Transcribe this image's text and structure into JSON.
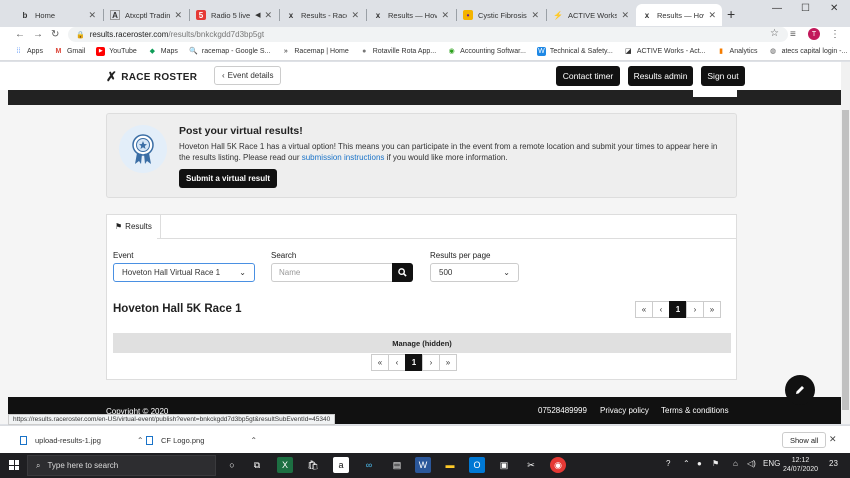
{
  "browser": {
    "tabs": [
      {
        "title": "Home",
        "icon": "b"
      },
      {
        "title": "Atxcptl Trading Pl",
        "icon": "A"
      },
      {
        "title": "Radio 5 live",
        "icon": "5"
      },
      {
        "title": "Results - Race Ro",
        "icon": "x"
      },
      {
        "title": "Results — Hovet",
        "icon": "x"
      },
      {
        "title": "Cystic Fibrosis Tru",
        "icon": "•"
      },
      {
        "title": "ACTIVE Works",
        "icon": "⚡"
      },
      {
        "title": "Results — Hovet",
        "icon": "x"
      }
    ],
    "url_host": "results.raceroster.com",
    "url_path": "/results/bnkckgdd7d3bp5gt",
    "profile_initial": "T",
    "bookmarks": [
      "Apps",
      "Gmail",
      "YouTube",
      "Maps",
      "racemap - Google S...",
      "Racemap | Home",
      "Rotaville Rota App...",
      "Accounting Softwar...",
      "Technical & Safety...",
      "ACTIVE Works - Act...",
      "Analytics",
      "atecs capital login -..."
    ]
  },
  "site": {
    "logo_text": "RACE ROSTER",
    "event_details": "Event details",
    "contact_timer": "Contact timer",
    "results_admin": "Results admin",
    "sign_out": "Sign out"
  },
  "promo": {
    "title": "Post your virtual results!",
    "body_before_link": "Hoveton Hall 5K Race 1 has a virtual option! This means you can participate in the event from a remote location and submit your times to appear here in the results listing. Please read our ",
    "link_text": "submission instructions",
    "body_after_link": " if you would like more information.",
    "button": "Submit a virtual result"
  },
  "results": {
    "tab_label": "Results",
    "event_label": "Event",
    "event_value": "Hoveton Hall Virtual Race 1",
    "search_label": "Search",
    "search_placeholder": "Name",
    "per_page_label": "Results per page",
    "per_page_value": "500",
    "race_title": "Hoveton Hall 5K Race 1",
    "current_page": "1",
    "manage_label": "Manage (hidden)"
  },
  "footer": {
    "copyright": "Copyright © 2020",
    "phone": "07528489999",
    "privacy": "Privacy policy",
    "terms": "Terms & conditions"
  },
  "status_url": "https://results.raceroster.com/en-US/virtual-event/publish?event=bnkckgdd7d3bp5gt&resultSubEventId=45340",
  "downloads": {
    "items": [
      "upload-results-1.jpg",
      "CF Logo.png"
    ],
    "show_all": "Show all"
  },
  "taskbar": {
    "search_placeholder": "Type here to search",
    "lang": "ENG",
    "time": "12:12",
    "date": "24/07/2020",
    "notif_count": "23"
  }
}
